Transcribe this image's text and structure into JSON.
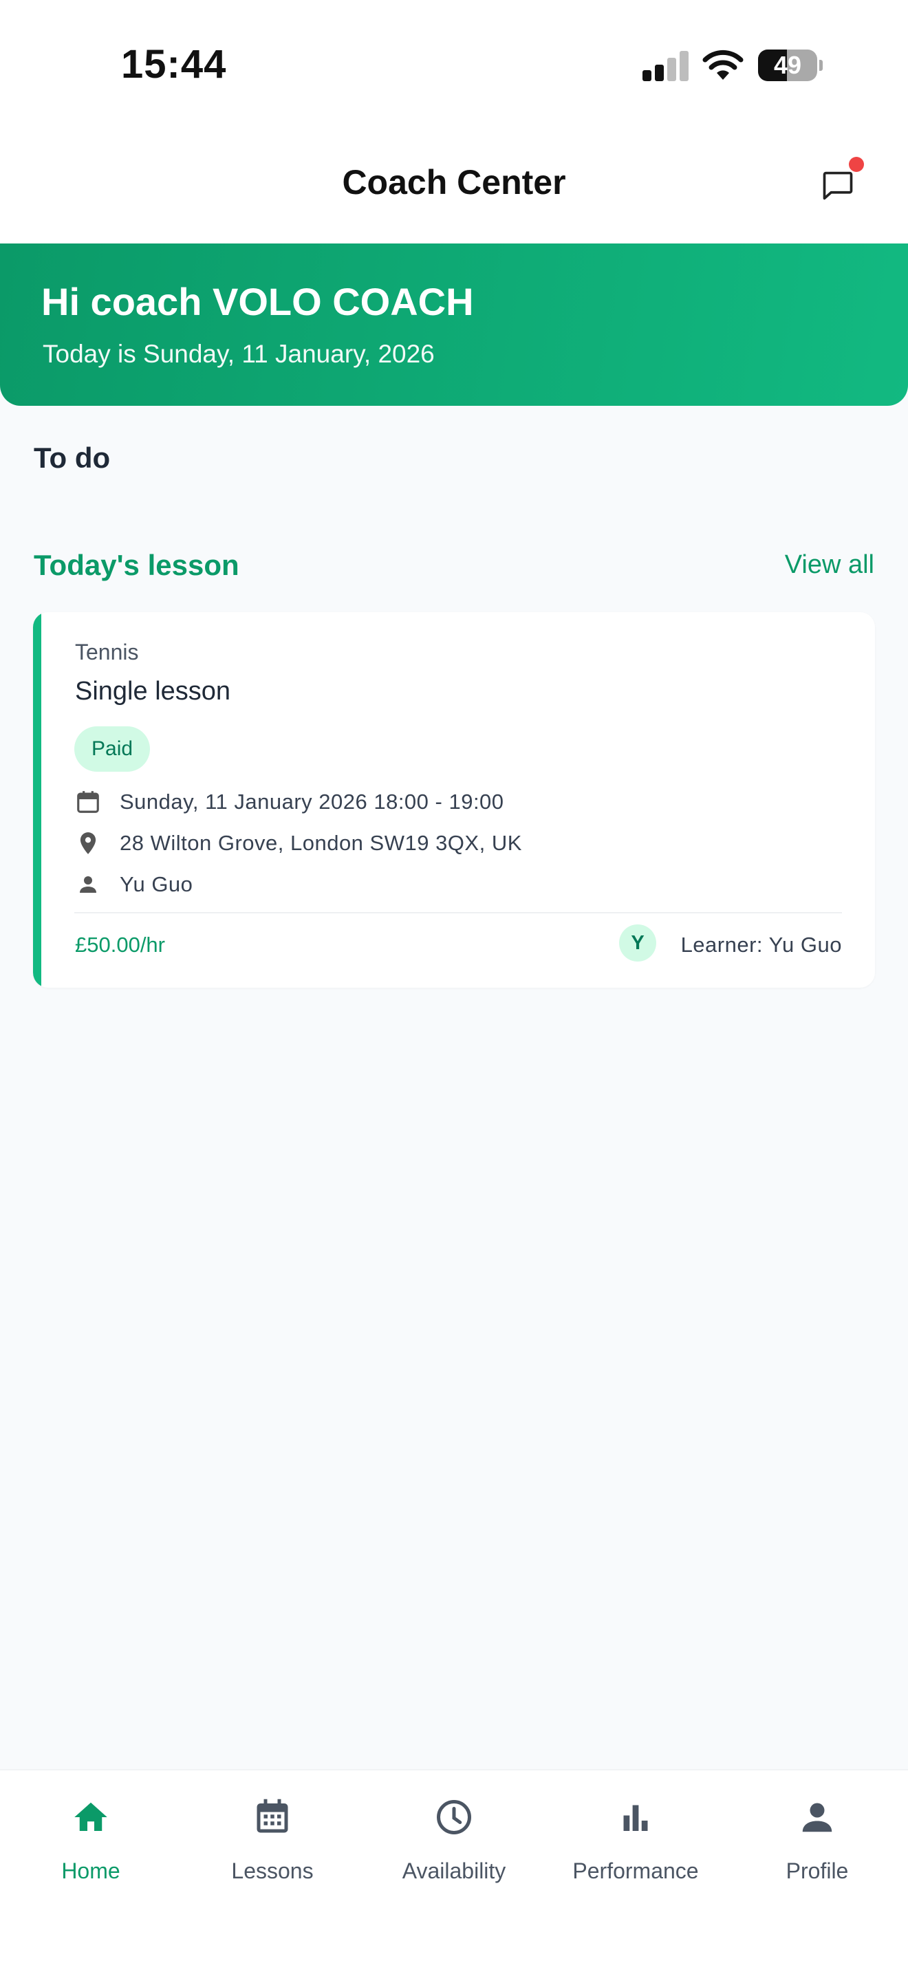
{
  "status_bar": {
    "time": "15:44",
    "battery_level": "49",
    "battery_fraction": 0.49,
    "signal_bars_active": 2,
    "signal_bars_total": 4
  },
  "header": {
    "title": "Coach Center",
    "chat_icon": "chat-bubble-icon",
    "has_notification": true
  },
  "banner": {
    "greeting": "Hi coach VOLO COACH",
    "date_line": "Today is Sunday, 11 January, 2026"
  },
  "todo": {
    "title": "To do"
  },
  "todays_lesson": {
    "title": "Today's lesson",
    "view_all": "View all",
    "card": {
      "sport": "Tennis",
      "type": "Single lesson",
      "status": "Paid",
      "datetime": "Sunday, 11 January 2026 18:00 - 19:00",
      "location": "28 Wilton Grove, London SW19 3QX, UK",
      "person": "Yu Guo",
      "price": "£50.00/hr",
      "learner_initial": "Y",
      "learner_label": "Learner: Yu Guo"
    }
  },
  "nav": {
    "items": [
      {
        "label": "Home",
        "icon": "home-icon",
        "active": true
      },
      {
        "label": "Lessons",
        "icon": "calendar-icon",
        "active": false
      },
      {
        "label": "Availability",
        "icon": "clock-icon",
        "active": false
      },
      {
        "label": "Performance",
        "icon": "bar-chart-icon",
        "active": false
      },
      {
        "label": "Profile",
        "icon": "person-icon",
        "active": false
      }
    ]
  },
  "colors": {
    "brand": "#0B9A68",
    "brand_light": "#12B981",
    "badge_bg": "#D1FAE5",
    "notification": "#EF4444",
    "background": "#F8FAFC"
  }
}
